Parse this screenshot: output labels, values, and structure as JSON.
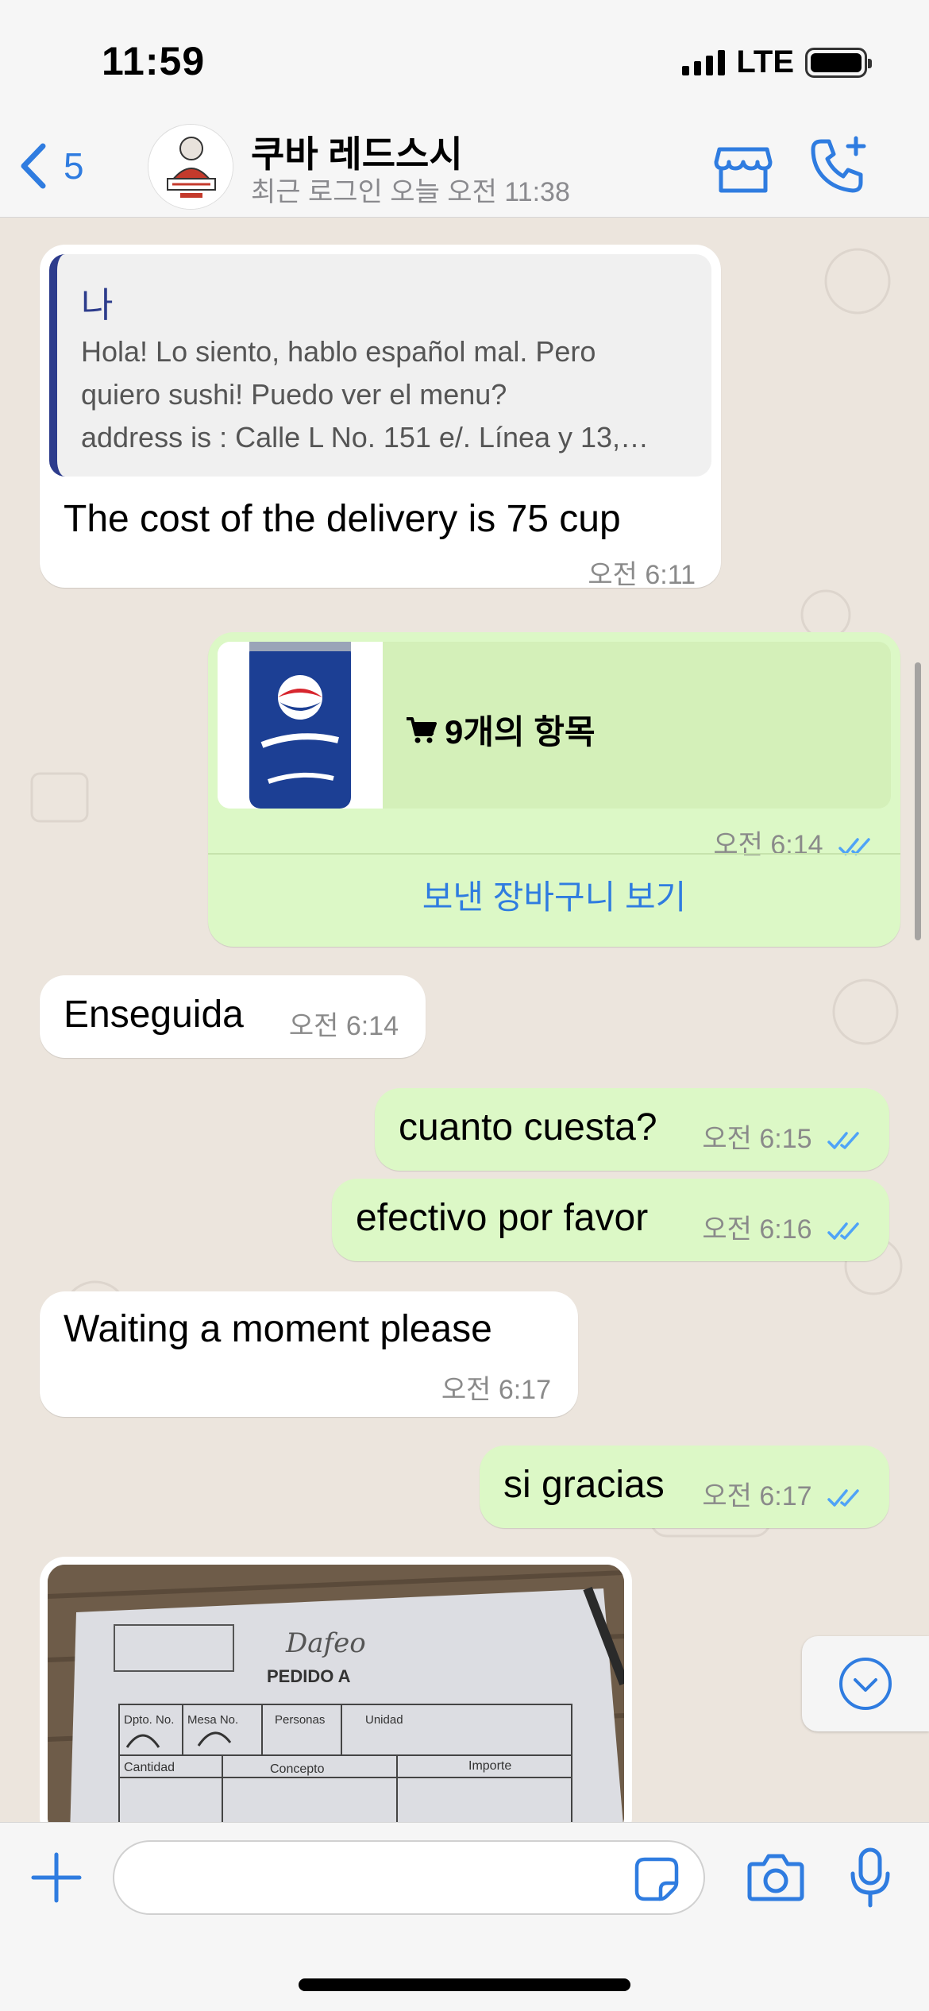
{
  "status_bar": {
    "time": "11:59",
    "network": "LTE"
  },
  "header": {
    "back_count": "5",
    "contact_name": "쿠바 레드스시",
    "last_seen": "최근 로그인 오늘 오전 11:38"
  },
  "messages": [
    {
      "direction": "in",
      "quote": {
        "author": "나",
        "lines": [
          "Hola! Lo siento, hablo español mal. Pero",
          "quiero sushi! Puedo ver el menu?",
          "address is : Calle L No. 151 e/. Línea y 13,…"
        ]
      },
      "text": "The cost of the delivery is 75 cup",
      "time": "오전 6:11"
    },
    {
      "direction": "out",
      "cart": {
        "label": "9개의 항목",
        "link": "보낸 장바구니 보기"
      },
      "time": "오전 6:14",
      "read": true
    },
    {
      "direction": "in",
      "text": "Enseguida",
      "time": "오전 6:14"
    },
    {
      "direction": "out",
      "text": "cuanto cuesta?",
      "time": "오전 6:15",
      "read": true
    },
    {
      "direction": "out",
      "text": "efectivo por favor",
      "time": "오전 6:16",
      "read": true
    },
    {
      "direction": "in",
      "text": "Waiting a moment please",
      "time": "오전 6:17"
    },
    {
      "direction": "out",
      "text": "si gracias",
      "time": "오전 6:17",
      "read": true
    },
    {
      "direction": "in",
      "type": "photo",
      "photo": {
        "handwriting": "Dafeo",
        "title": "PEDIDO A",
        "cols": [
          "Dpto. No.",
          "Mesa No.",
          "Personas",
          "Unidad"
        ],
        "row_header": [
          "Cantidad",
          "Concepto",
          "Importe"
        ]
      }
    }
  ],
  "colors": {
    "accent": "#2f7ce0",
    "outgoing_bubble": "#dcf8c6",
    "incoming_bubble": "#ffffff",
    "chat_background": "#ece5dd",
    "read_ticks": "#4fa3f7"
  },
  "icons": {
    "back": "chevron-left-icon",
    "store": "storefront-icon",
    "call": "phone-plus-icon",
    "cart": "shopping-cart-icon",
    "scroll_down": "chevron-down-circle-icon",
    "attach": "plus-icon",
    "sticker": "sticker-icon",
    "camera": "camera-icon",
    "mic": "microphone-icon"
  }
}
